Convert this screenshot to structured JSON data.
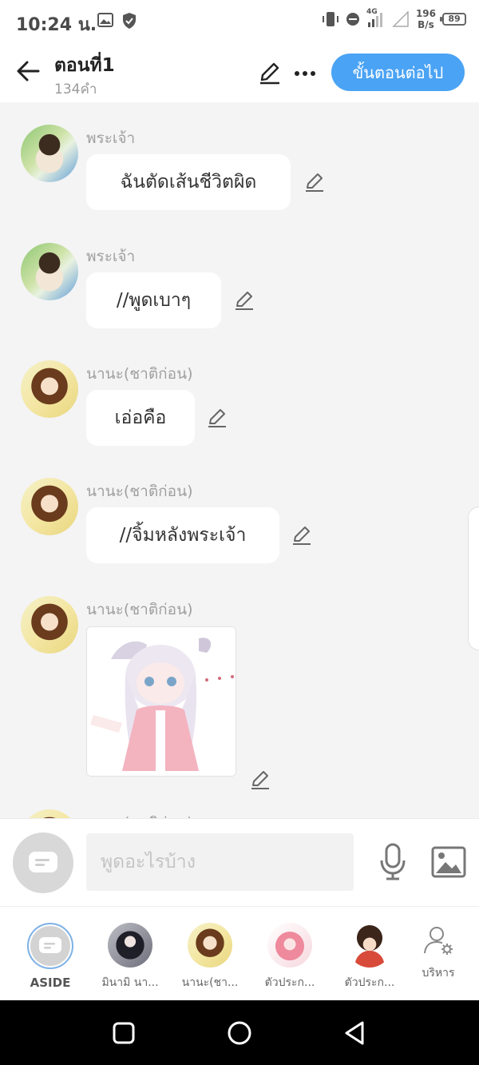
{
  "status_bar": {
    "time": "10:24 น.",
    "network": "4G",
    "speed_value": "196",
    "speed_unit": "B/s",
    "battery": "89"
  },
  "header": {
    "title": "ตอนที่1",
    "word_count": "134คำ",
    "next_button": "ขั้นตอนต่อไป",
    "accent_color": "#4aa3f4"
  },
  "messages": [
    {
      "sender": "พระเจ้า",
      "text": "ฉันตัดเส้นชีวิตผิด",
      "avatar": "god"
    },
    {
      "sender": "พระเจ้า",
      "text": "//พูดเบาๆ",
      "avatar": "god"
    },
    {
      "sender": "นานะ(ชาติก่อน)",
      "text": "เอ่อคือ",
      "avatar": "nana"
    },
    {
      "sender": "นานะ(ชาติก่อน)",
      "text": "//จิ้มหลังพระเจ้า",
      "avatar": "nana"
    },
    {
      "sender": "นานะ(ชาติก่อน)",
      "image": "anime-girl-pink-dress",
      "avatar": "nana"
    },
    {
      "sender": "นานะ(ชาติก่อน)",
      "avatar": "nana"
    }
  ],
  "input": {
    "placeholder": "พูดอะไรบ้าง"
  },
  "characters": [
    {
      "label": "ASIDE"
    },
    {
      "label": "มินามิ นา..."
    },
    {
      "label": "นานะ(ชา..."
    },
    {
      "label": "ตัวประก..."
    },
    {
      "label": "ตัวประก..."
    }
  ],
  "admin": {
    "label": "บริหาร"
  }
}
